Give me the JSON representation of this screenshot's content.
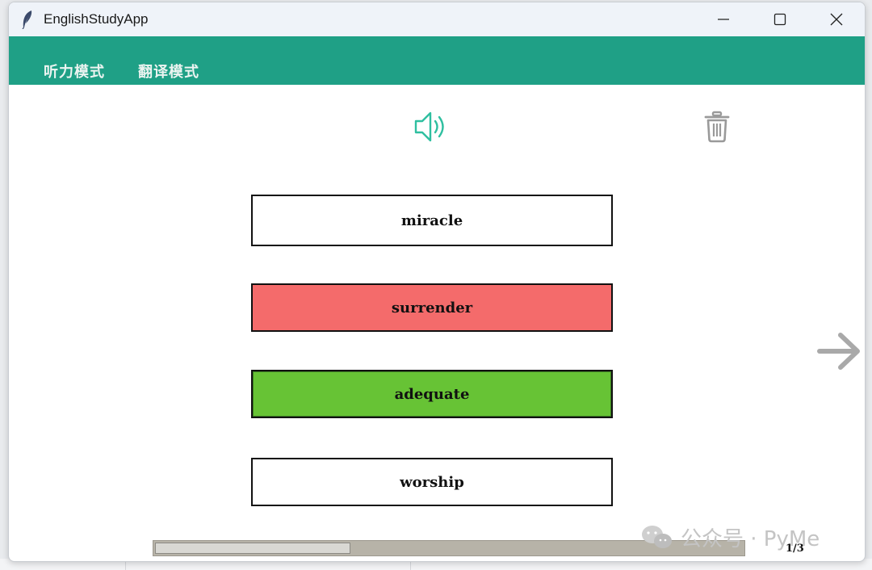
{
  "window": {
    "title": "EnglishStudyApp"
  },
  "menu": {
    "items": [
      "听力模式",
      "翻译模式"
    ]
  },
  "options": [
    {
      "label": "miracle",
      "state": "normal",
      "color": "#ffffff"
    },
    {
      "label": "surrender",
      "state": "wrong",
      "color": "#f46b6b"
    },
    {
      "label": "adequate",
      "state": "correct",
      "color": "#67c335"
    },
    {
      "label": "worship",
      "state": "normal",
      "color": "#ffffff"
    }
  ],
  "icons": {
    "app": "feather-icon",
    "speaker": "speaker-icon",
    "trash": "trash-icon",
    "next": "arrow-right-icon",
    "minimize": "minimize-icon",
    "maximize": "maximize-icon",
    "close": "close-icon"
  },
  "progress": {
    "fraction": 0.33,
    "label": "1/3"
  },
  "watermark": {
    "text": "公众号 · PyMe"
  },
  "colors": {
    "accent": "#1fa086",
    "speaker": "#2fbfa0",
    "wrong": "#f46b6b",
    "correct": "#67c335",
    "icon_gray": "#9a9a9a"
  }
}
